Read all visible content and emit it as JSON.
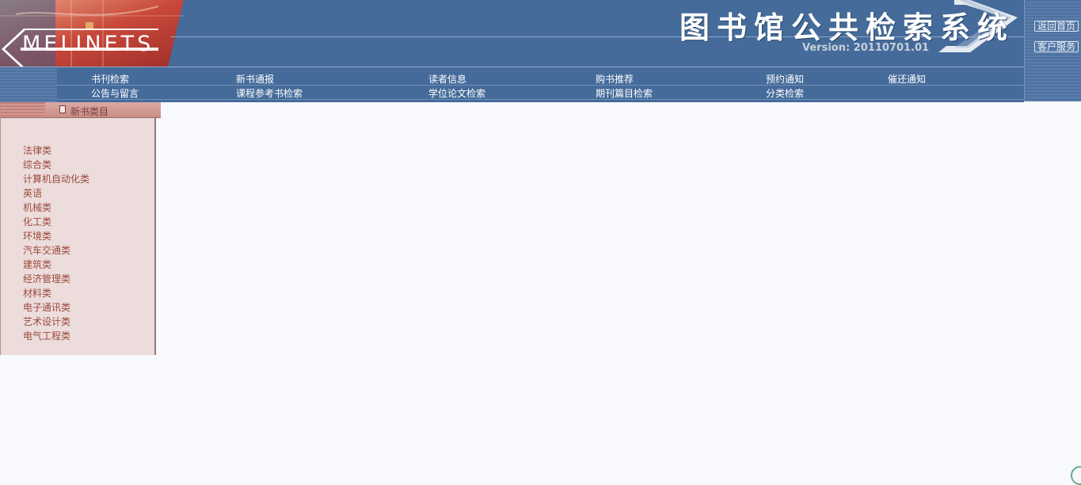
{
  "header": {
    "logo_text": "MELINETS",
    "system_title": "图书馆公共检索系统",
    "version": "Version: 20110701.01",
    "top_buttons": [
      "返回首页",
      "客户服务"
    ]
  },
  "nav": {
    "row1": [
      "书刊检索",
      "新书通报",
      "读者信息",
      "购书推荐",
      "预约通知",
      "催还通知"
    ],
    "row2": [
      "公告与留言",
      "课程参考书检索",
      "学位论文检索",
      "期刊篇目检索",
      "分类检索"
    ]
  },
  "sidebar": {
    "title": "新书类目",
    "categories": [
      "法律类",
      "综合类",
      "计算机自动化类",
      "英语",
      "机械类",
      "化工类",
      "环境类",
      "汽车交通类",
      "建筑类",
      "经济管理类",
      "材料类",
      "电子通讯类",
      "艺术设计类",
      "电气工程类"
    ]
  },
  "colors": {
    "banner": "#456b9a",
    "sidebar_bg": "#ecdcdc",
    "category_text": "#9b4a3a",
    "page_bg": "#f7f9fd"
  }
}
